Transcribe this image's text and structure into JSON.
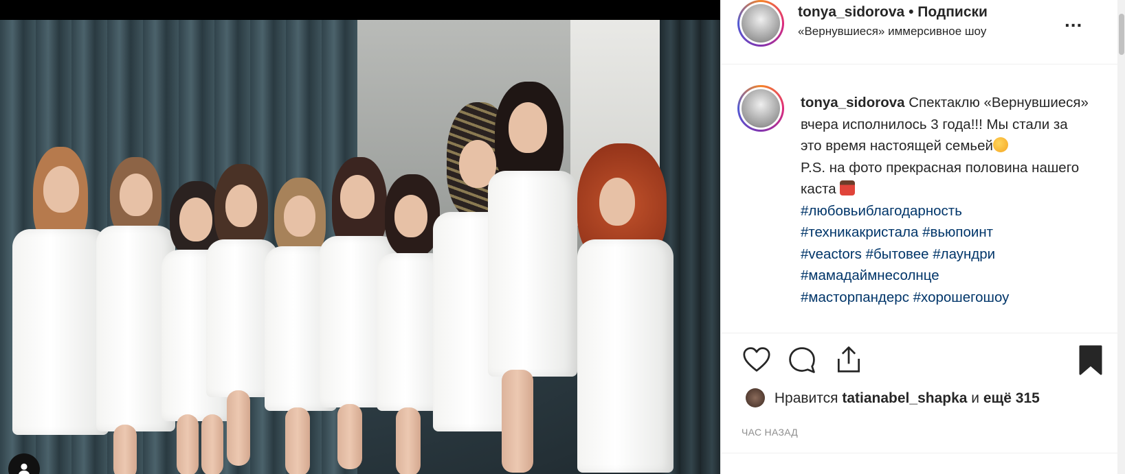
{
  "post": {
    "image_alt": "Group photo of women in white shirts",
    "account_icon": "user-icon"
  },
  "header": {
    "username": "tonya_sidorova",
    "separator": "•",
    "follow_label": "Подписки",
    "subtitle": "«Вернувшиеся» иммерсивное шоу",
    "more_label": "..."
  },
  "caption": {
    "username": "tonya_sidorova",
    "text_1": "Спектаклю «Вернувшиеся» вчера исполнилось 3 года!!! Мы стали за это время настоящей семьей",
    "text_2": "P.S. на фото прекрасная половина нашего каста",
    "hashtags": [
      "#любовьиблагодарность",
      "#техникакристала",
      "#вьюпоинт",
      "#veactors",
      "#бытовее",
      "#лаундри",
      "#мамадаймнесолнце",
      "#масторпандерс",
      "#хорошегошоу"
    ]
  },
  "actions": {
    "like_icon": "heart-icon",
    "comment_icon": "comment-icon",
    "share_icon": "share-icon",
    "save_icon": "bookmark-icon"
  },
  "likes": {
    "prefix": "Нравится",
    "user": "tatianabel_shapka",
    "middle": "и",
    "more": "ещё 315"
  },
  "time": "ЧАС НАЗАД",
  "colors": {
    "hashtag": "#003569",
    "muted": "#8e8e8e",
    "border": "#efefef"
  }
}
